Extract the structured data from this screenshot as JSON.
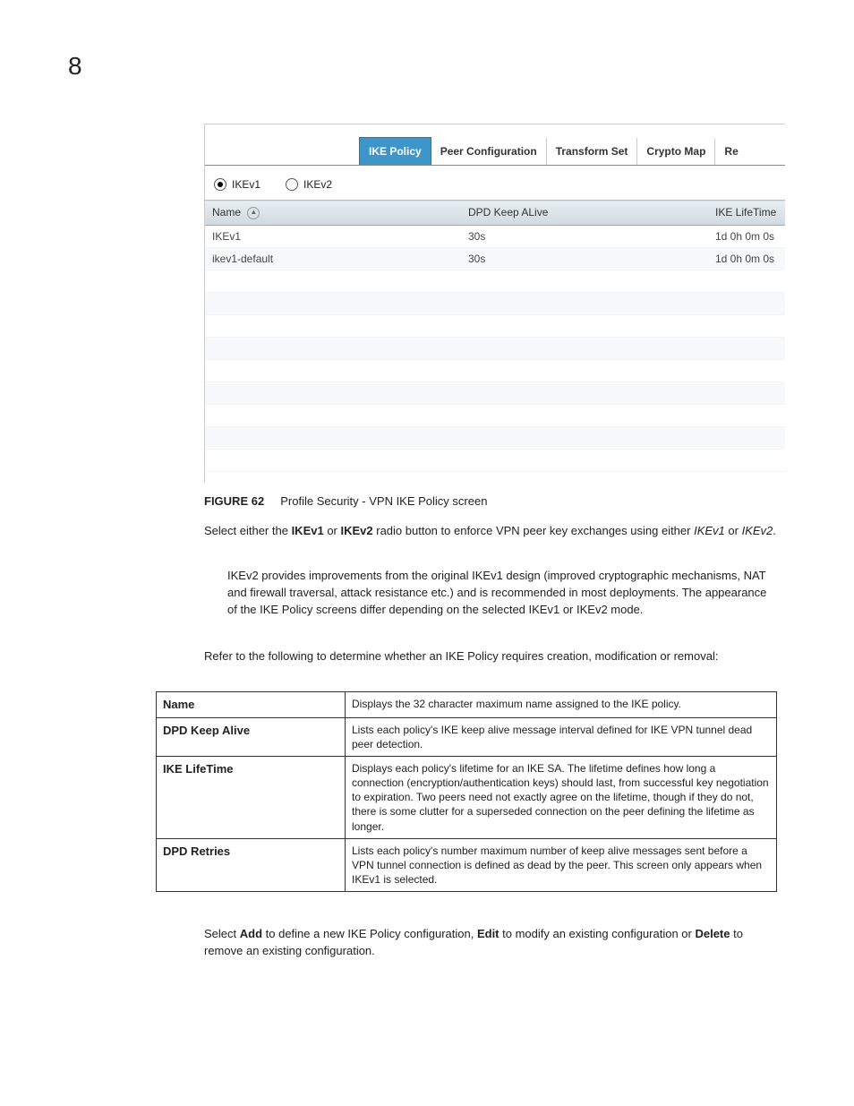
{
  "page_number": "8",
  "screenshot": {
    "tabs": {
      "ike_policy": "IKE Policy",
      "peer_configuration": "Peer Configuration",
      "transform_set": "Transform Set",
      "crypto_map": "Crypto Map",
      "remote_partial": "Re"
    },
    "radios": {
      "ikev1": "IKEv1",
      "ikev2": "IKEv2"
    },
    "columns": {
      "name": "Name",
      "dpd_keep_alive": "DPD Keep ALive",
      "ike_lifetime": "IKE LifeTime"
    },
    "rows": [
      {
        "name": "IKEv1",
        "dpd": "30s",
        "lifetime": "1d 0h 0m 0s"
      },
      {
        "name": "ikev1-default",
        "dpd": "30s",
        "lifetime": "1d 0h 0m 0s"
      }
    ]
  },
  "figure": {
    "label": "FIGURE 62",
    "caption": "Profile Security - VPN IKE Policy screen"
  },
  "para1": {
    "pre": "Select either the ",
    "b1": "IKEv1",
    "mid1": " or ",
    "b2": "IKEv2",
    "mid2": " radio button to enforce VPN peer key exchanges using either ",
    "i1": "IKEv1",
    "mid3": " or ",
    "i2": "IKEv2",
    "end": "."
  },
  "para_indent": "IKEv2 provides improvements from the original IKEv1 design (improved cryptographic mechanisms, NAT and firewall traversal, attack resistance etc.) and is recommended in most deployments. The appearance of the IKE Policy screens differ depending on the selected IKEv1 or IKEv2 mode.",
  "para2": "Refer to the following to determine whether an IKE Policy requires creation, modification or removal:",
  "desc_table": {
    "rows": [
      {
        "term": "Name",
        "desc": "Displays the 32 character maximum name assigned to the IKE policy."
      },
      {
        "term": "DPD Keep Alive",
        "desc": "Lists each policy's IKE keep alive message interval defined for IKE VPN tunnel dead peer detection."
      },
      {
        "term": "IKE LifeTime",
        "desc": "Displays each policy's lifetime for an IKE SA. The lifetime defines how long a connection (encryption/authentication keys) should last, from successful key negotiation to expiration. Two peers need not exactly agree on the lifetime, though if they do not, there is some clutter for a superseded connection on the peer defining the lifetime as longer."
      },
      {
        "term": "DPD Retries",
        "desc": "Lists each policy's number maximum number of keep alive messages sent before a VPN tunnel connection is defined as dead by the peer. This screen only appears when IKEv1 is selected."
      }
    ]
  },
  "para3": {
    "pre": "Select ",
    "b1": "Add",
    "mid1": " to define a new IKE Policy configuration, ",
    "b2": "Edit",
    "mid2": " to modify an existing configuration or ",
    "b3": "Delete",
    "end": " to remove an existing configuration."
  }
}
